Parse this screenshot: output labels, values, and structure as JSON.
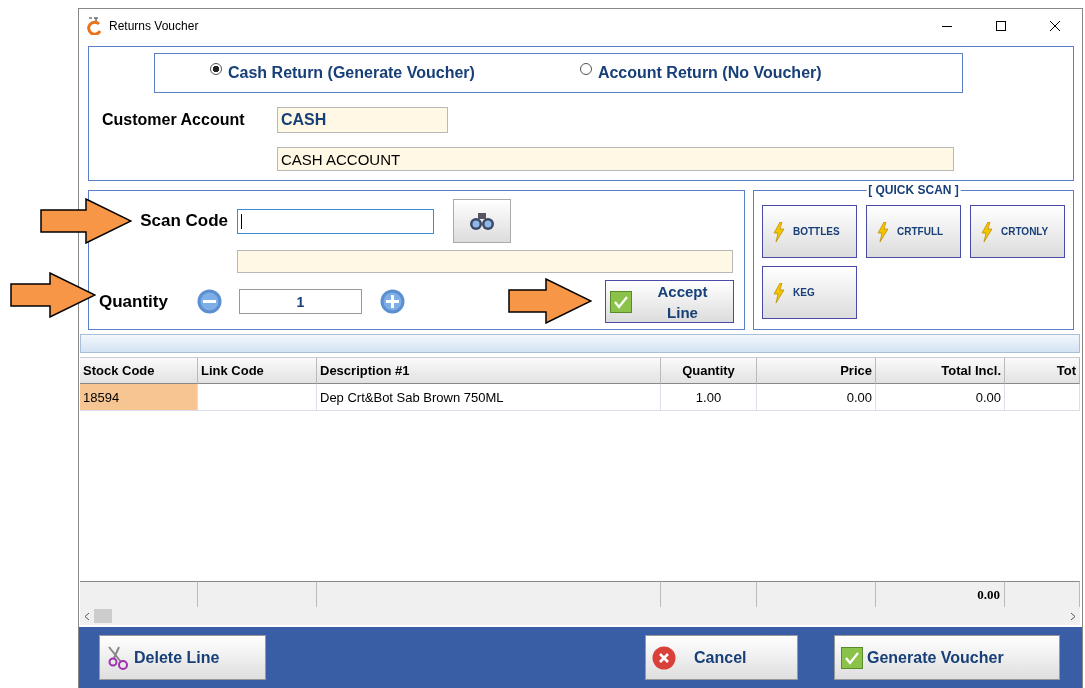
{
  "window": {
    "title": "Returns Voucher"
  },
  "return_type": [
    {
      "label": "Cash Return (Generate Voucher)",
      "selected": true
    },
    {
      "label": "Account Return (No Voucher)",
      "selected": false
    }
  ],
  "customer_account": {
    "label": "Customer Account",
    "code": "CASH",
    "name": "CASH ACCOUNT"
  },
  "scan": {
    "label": "Scan Code"
  },
  "quantity": {
    "label": "Quantity",
    "value": "1"
  },
  "accept_button": {
    "label": "Accept Line"
  },
  "quick_scan": {
    "title": "[ QUICK SCAN ]",
    "buttons": [
      "BOTTLES",
      "CRTFULL",
      "CRTONLY",
      "KEG"
    ]
  },
  "table": {
    "columns": [
      "Stock Code",
      "Link Code",
      "Description #1",
      "Quantity",
      "Price",
      "Total Incl.",
      "Tot"
    ],
    "rows": [
      {
        "cells": [
          "18594",
          null,
          "Dep Crt&Bot Sab Brown 750ML",
          "1.00",
          "0.00",
          "0.00",
          null
        ],
        "selected": true
      }
    ],
    "total_incl": "0.00"
  },
  "actions": [
    {
      "label": "Delete Line",
      "kind": "delete"
    },
    {
      "label": "Cancel",
      "kind": "cancel"
    },
    {
      "label": "Generate Voucher",
      "kind": "confirm"
    }
  ]
}
